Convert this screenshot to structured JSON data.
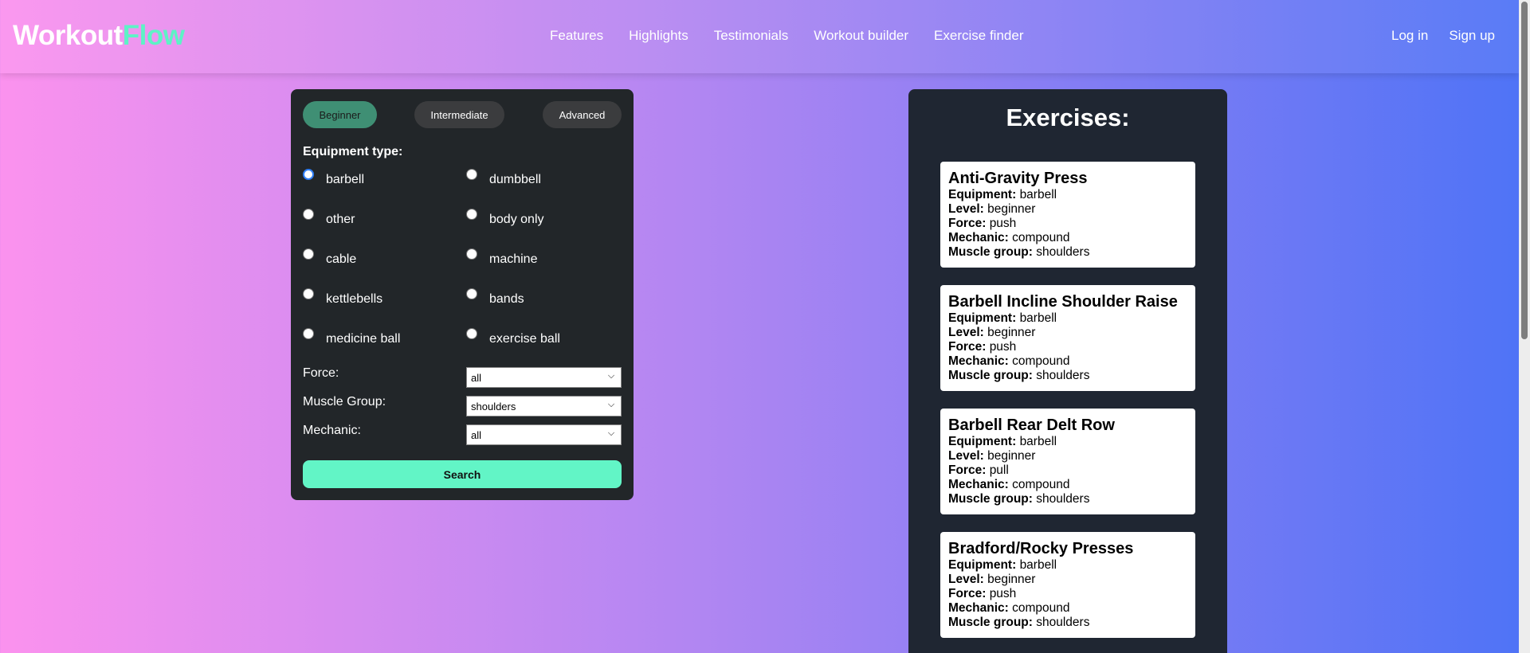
{
  "brand": {
    "part1": "Workout",
    "part2": "Flow"
  },
  "nav": [
    "Features",
    "Highlights",
    "Testimonials",
    "Workout builder",
    "Exercise finder"
  ],
  "auth": {
    "login": "Log in",
    "signup": "Sign up"
  },
  "levels": {
    "beginner": "Beginner",
    "intermediate": "Intermediate",
    "advanced": "Advanced",
    "selected": "Beginner"
  },
  "equipment": {
    "label": "Equipment type:",
    "options": [
      "barbell",
      "dumbbell",
      "other",
      "body only",
      "cable",
      "machine",
      "kettlebells",
      "bands",
      "medicine ball",
      "exercise ball"
    ],
    "selected": "barbell"
  },
  "filters": {
    "force": {
      "label": "Force:",
      "value": "all"
    },
    "muscle": {
      "label": "Muscle Group:",
      "value": "shoulders"
    },
    "mechanic": {
      "label": "Mechanic:",
      "value": "all"
    }
  },
  "search_label": "Search",
  "exercises": {
    "title": "Exercises:",
    "field_labels": {
      "equipment": "Equipment:",
      "level": "Level:",
      "force": "Force:",
      "mechanic": "Mechanic:",
      "muscle": "Muscle group:"
    },
    "items": [
      {
        "name": "Anti-Gravity Press",
        "equipment": "barbell",
        "level": "beginner",
        "force": "push",
        "mechanic": "compound",
        "muscle": "shoulders"
      },
      {
        "name": "Barbell Incline Shoulder Raise",
        "equipment": "barbell",
        "level": "beginner",
        "force": "push",
        "mechanic": "compound",
        "muscle": "shoulders"
      },
      {
        "name": "Barbell Rear Delt Row",
        "equipment": "barbell",
        "level": "beginner",
        "force": "pull",
        "mechanic": "compound",
        "muscle": "shoulders"
      },
      {
        "name": "Bradford/Rocky Presses",
        "equipment": "barbell",
        "level": "beginner",
        "force": "push",
        "mechanic": "compound",
        "muscle": "shoulders"
      }
    ]
  },
  "colors": {
    "accent": "#62f5c6",
    "panel": "#222629",
    "exercise_panel": "#1f2632"
  }
}
